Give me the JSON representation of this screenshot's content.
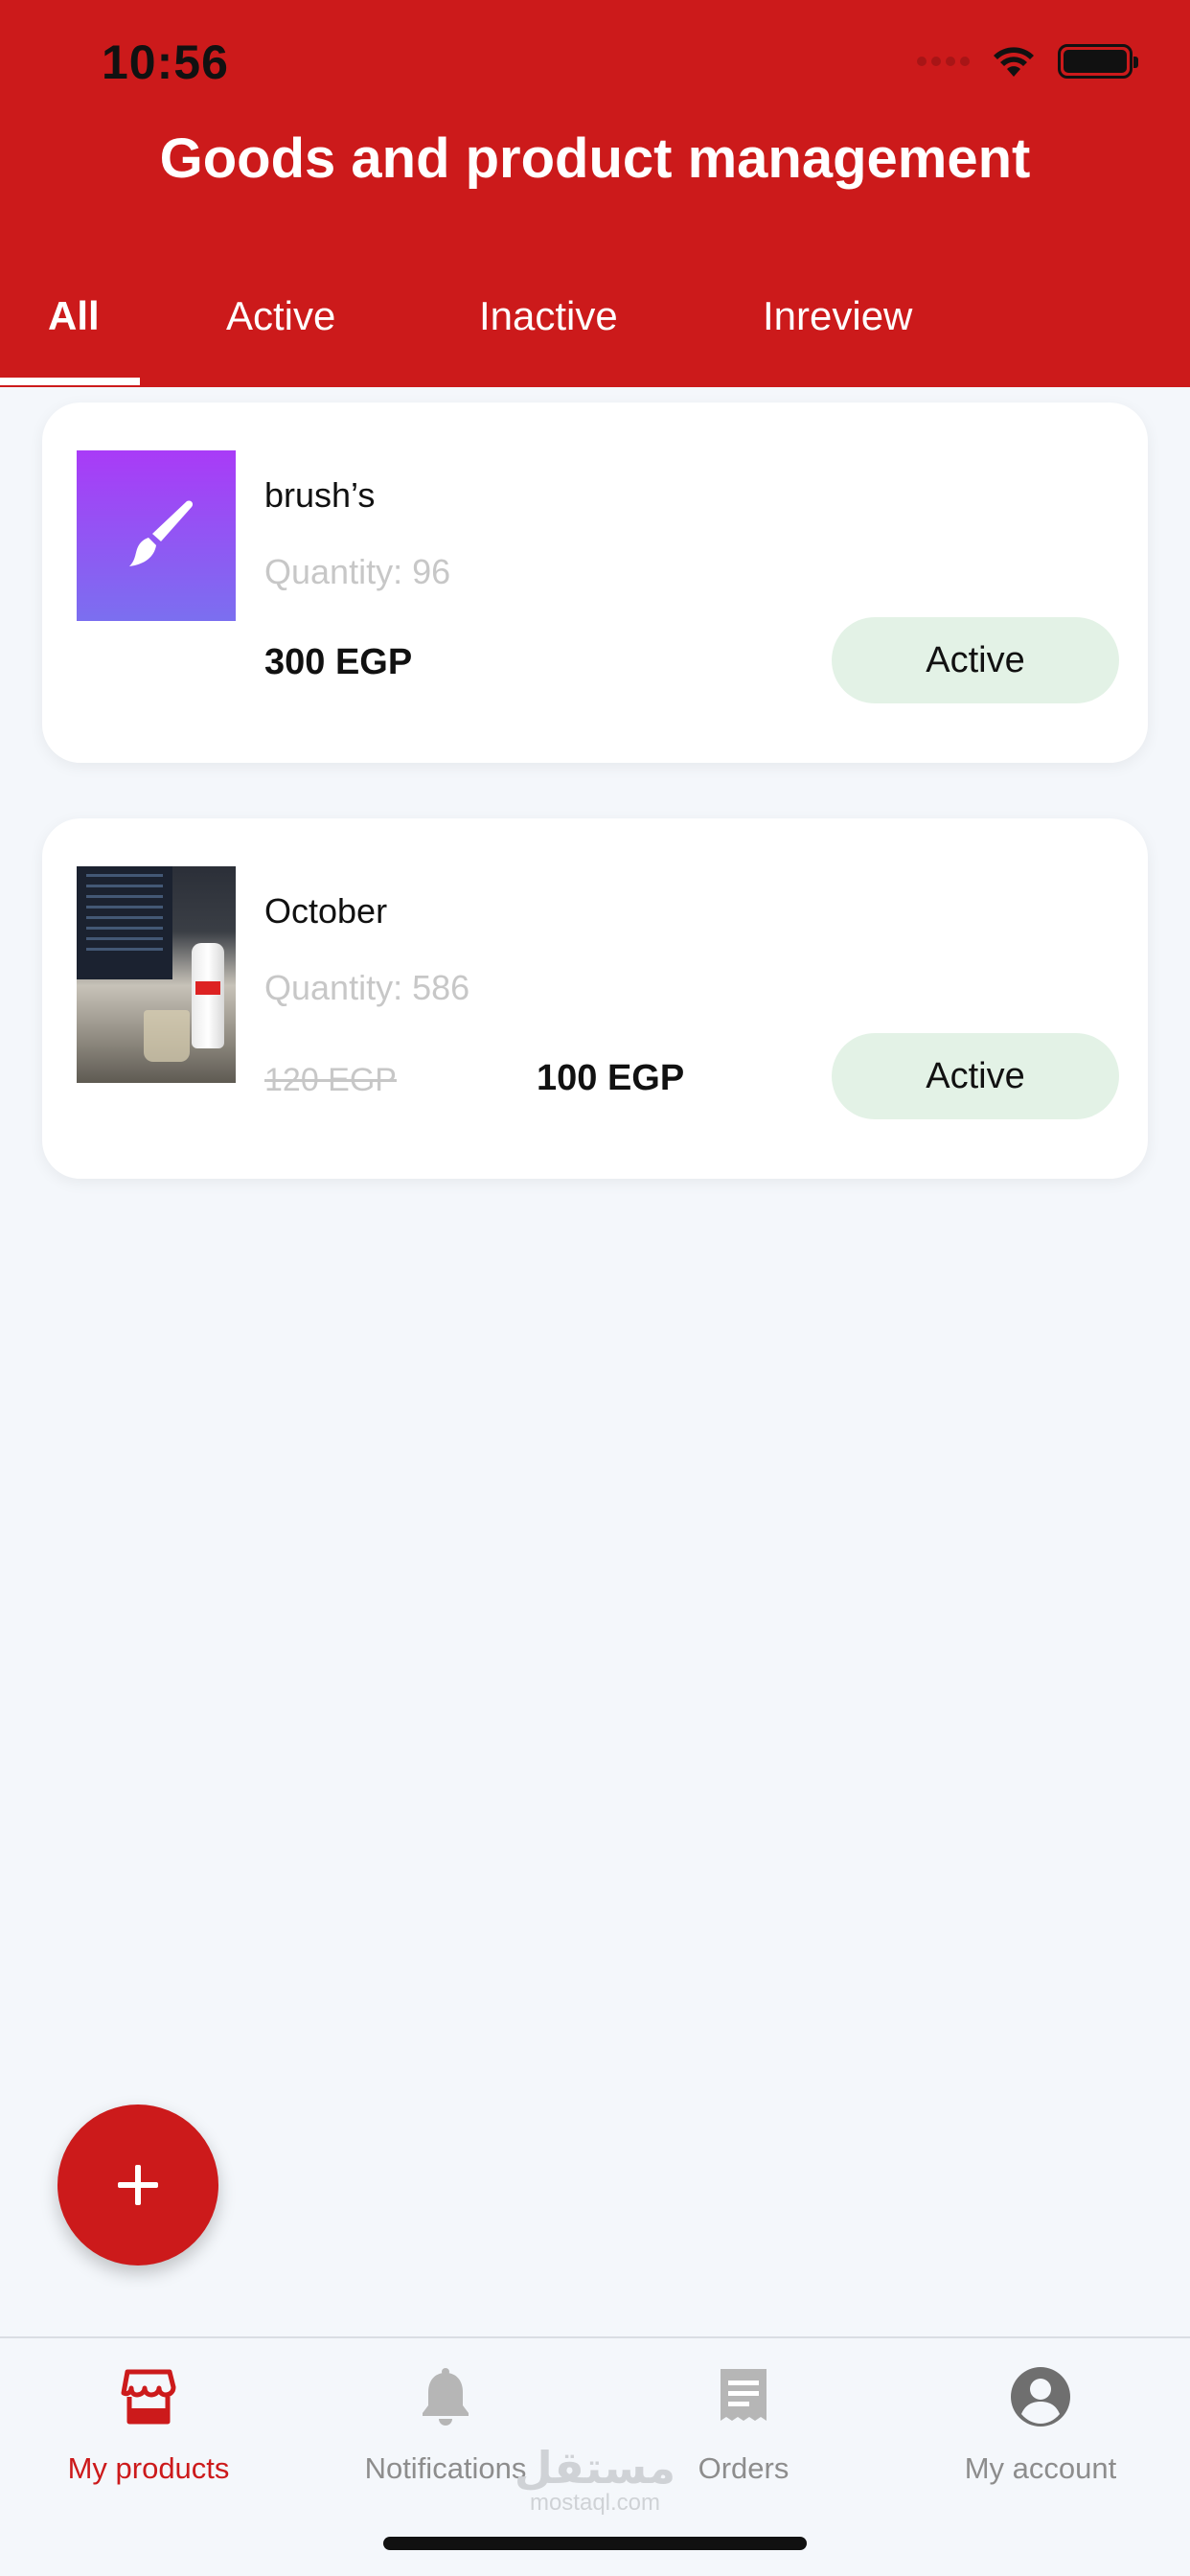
{
  "status_bar": {
    "time": "10:56"
  },
  "header": {
    "title": "Goods and product management"
  },
  "tabs": [
    {
      "label": "All",
      "selected": true
    },
    {
      "label": "Active"
    },
    {
      "label": "Inactive"
    },
    {
      "label": "Inreview"
    }
  ],
  "products": [
    {
      "name": "brush’s",
      "quantity": "Quantity: 96",
      "price": "300 EGP",
      "status": "Active",
      "thumbnail_icon": "paintbrush-icon"
    },
    {
      "name": "October",
      "quantity": "Quantity: 586",
      "old_price": "120 EGP",
      "price": "100 EGP",
      "status": "Active",
      "thumbnail_icon": "product-photo"
    }
  ],
  "fab": {
    "icon": "plus-icon"
  },
  "bottom_nav": [
    {
      "label": "My products",
      "icon": "store-icon",
      "active": true
    },
    {
      "label": "Notifications",
      "icon": "bell-icon"
    },
    {
      "label": "Orders",
      "icon": "receipt-icon"
    },
    {
      "label": "My account",
      "icon": "account-icon"
    }
  ],
  "watermark": {
    "arabic": "مستقل",
    "latin": "mostaql.com"
  },
  "colors": {
    "primary": "#cc1a1b",
    "badge_bg": "#e3f2e6",
    "background": "#f4f7fb",
    "muted_text": "#c7c7c7",
    "nav_inactive": "#8d8d8d"
  }
}
